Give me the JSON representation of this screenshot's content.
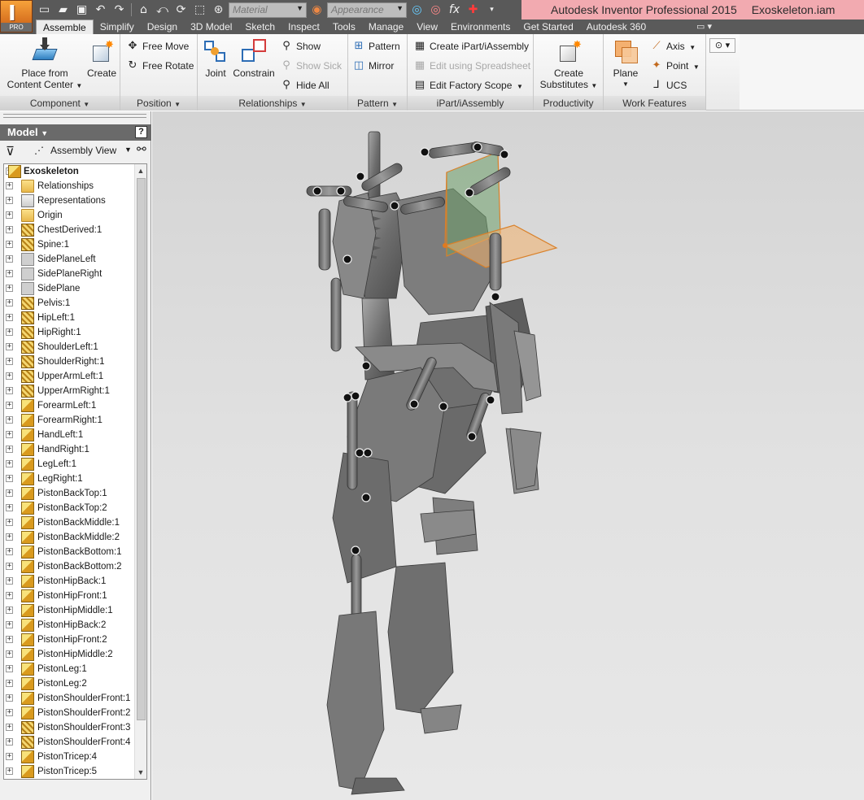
{
  "app": {
    "product": "Autodesk Inventor Professional 2015",
    "document": "Exoskeleton.iam",
    "badge": "PRO"
  },
  "quick_access": {
    "material_placeholder": "Material",
    "appearance_placeholder": "Appearance",
    "fx": "fx"
  },
  "tabs": [
    "Assemble",
    "Simplify",
    "Design",
    "3D Model",
    "Sketch",
    "Inspect",
    "Tools",
    "Manage",
    "View",
    "Environments",
    "Get Started",
    "Autodesk 360"
  ],
  "active_tab": "Assemble",
  "ribbon": {
    "component": {
      "title": "Component",
      "place_line1": "Place from",
      "place_line2": "Content Center",
      "create": "Create"
    },
    "position": {
      "title": "Position",
      "free_move": "Free Move",
      "free_rotate": "Free Rotate"
    },
    "relationships": {
      "title": "Relationships",
      "joint": "Joint",
      "constrain": "Constrain",
      "show": "Show",
      "show_sick": "Show Sick",
      "hide_all": "Hide All"
    },
    "pattern": {
      "title": "Pattern",
      "pattern": "Pattern",
      "mirror": "Mirror"
    },
    "ipart": {
      "title": "iPart/iAssembly",
      "create": "Create iPart/iAssembly",
      "edit_spreadsheet": "Edit using Spreadsheet",
      "edit_factory": "Edit Factory Scope"
    },
    "productivity": {
      "title": "Productivity",
      "create_substitutes_line1": "Create",
      "create_substitutes_line2": "Substitutes"
    },
    "work_features": {
      "title": "Work Features",
      "plane": "Plane",
      "axis": "Axis",
      "point": "Point",
      "ucs": "UCS"
    }
  },
  "browser": {
    "title": "Model",
    "help": "?",
    "view_mode": "Assembly View",
    "root": "Exoskeleton",
    "nodes": [
      {
        "label": "Relationships",
        "icon": "folder"
      },
      {
        "label": "Representations",
        "icon": "rep"
      },
      {
        "label": "Origin",
        "icon": "folder"
      },
      {
        "label": "ChestDerived:1",
        "icon": "derived"
      },
      {
        "label": "Spine:1",
        "icon": "derived"
      },
      {
        "label": "SidePlaneLeft",
        "icon": "plane"
      },
      {
        "label": "SidePlaneRight",
        "icon": "plane"
      },
      {
        "label": "SidePlane",
        "icon": "plane"
      },
      {
        "label": "Pelvis:1",
        "icon": "derived"
      },
      {
        "label": "HipLeft:1",
        "icon": "derived"
      },
      {
        "label": "HipRight:1",
        "icon": "derived"
      },
      {
        "label": "ShoulderLeft:1",
        "icon": "derived"
      },
      {
        "label": "ShoulderRight:1",
        "icon": "derived"
      },
      {
        "label": "UpperArmLeft:1",
        "icon": "derived"
      },
      {
        "label": "UpperArmRight:1",
        "icon": "derived"
      },
      {
        "label": "ForearmLeft:1",
        "icon": "comp"
      },
      {
        "label": "ForearmRight:1",
        "icon": "comp"
      },
      {
        "label": "HandLeft:1",
        "icon": "comp"
      },
      {
        "label": "HandRight:1",
        "icon": "comp"
      },
      {
        "label": "LegLeft:1",
        "icon": "comp"
      },
      {
        "label": "LegRight:1",
        "icon": "comp"
      },
      {
        "label": "PistonBackTop:1",
        "icon": "comp"
      },
      {
        "label": "PistonBackTop:2",
        "icon": "comp"
      },
      {
        "label": "PistonBackMiddle:1",
        "icon": "comp"
      },
      {
        "label": "PistonBackMiddle:2",
        "icon": "comp"
      },
      {
        "label": "PistonBackBottom:1",
        "icon": "comp"
      },
      {
        "label": "PistonBackBottom:2",
        "icon": "comp"
      },
      {
        "label": "PistonHipBack:1",
        "icon": "comp"
      },
      {
        "label": "PistonHipFront:1",
        "icon": "comp"
      },
      {
        "label": "PistonHipMiddle:1",
        "icon": "comp"
      },
      {
        "label": "PistonHipBack:2",
        "icon": "comp"
      },
      {
        "label": "PistonHipFront:2",
        "icon": "comp"
      },
      {
        "label": "PistonHipMiddle:2",
        "icon": "comp"
      },
      {
        "label": "PistonLeg:1",
        "icon": "comp"
      },
      {
        "label": "PistonLeg:2",
        "icon": "comp"
      },
      {
        "label": "PistonShoulderFront:1",
        "icon": "comp"
      },
      {
        "label": "PistonShoulderFront:2",
        "icon": "comp"
      },
      {
        "label": "PistonShoulderFront:3",
        "icon": "derived"
      },
      {
        "label": "PistonShoulderFront:4",
        "icon": "derived"
      },
      {
        "label": "PistonTricep:4",
        "icon": "comp"
      },
      {
        "label": "PistonTricep:5",
        "icon": "comp"
      }
    ]
  },
  "colors": {
    "title_bg": "#f2aab0",
    "app_button": "#e0782a",
    "work_plane": "#f0a050",
    "model_gray": "#7c7c7c"
  }
}
